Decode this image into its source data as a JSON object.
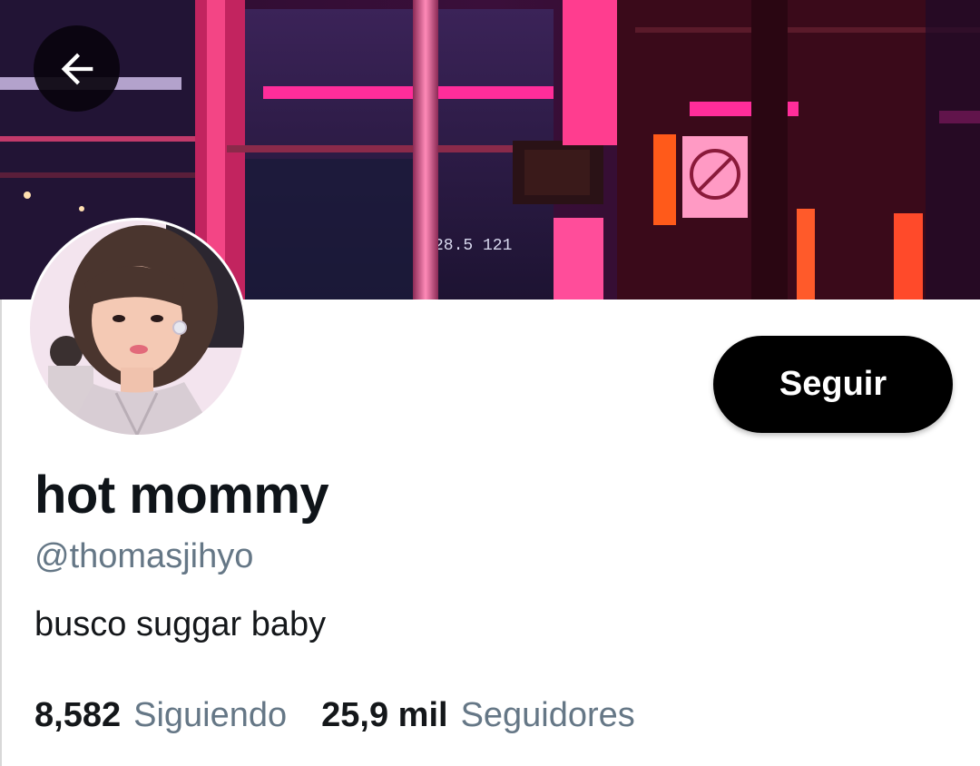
{
  "header": {
    "back_icon": "arrow-left-icon",
    "banner_text": "28.5 121"
  },
  "profile": {
    "display_name": "hot mommy",
    "handle": "@thomasjihyo",
    "bio": "busco suggar baby",
    "follow_label": "Seguir"
  },
  "stats": {
    "following_count": "8,582",
    "following_label": "Siguiendo",
    "followers_count": "25,9 mil",
    "followers_label": "Seguidores"
  },
  "colors": {
    "accent_pink": "#ff2d8a",
    "button_bg": "#000000",
    "secondary_text": "#657786"
  }
}
